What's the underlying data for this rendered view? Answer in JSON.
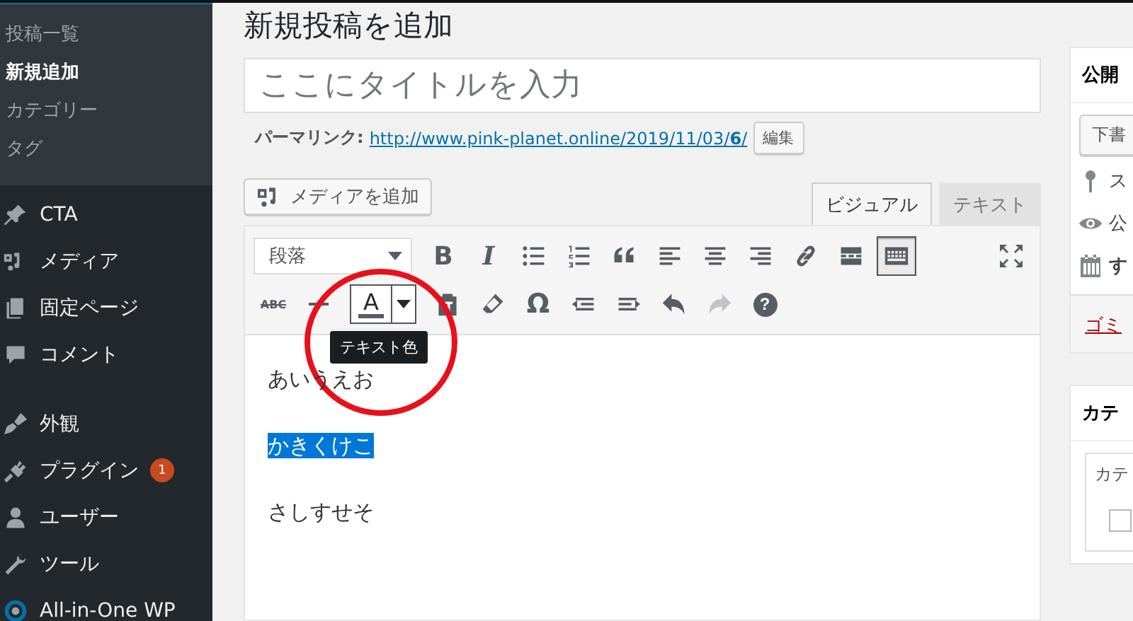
{
  "sidebar": {
    "submenu": [
      {
        "label": "投稿一覧",
        "selected": false
      },
      {
        "label": "新規追加",
        "selected": true
      },
      {
        "label": "カテゴリー",
        "selected": false
      },
      {
        "label": "タグ",
        "selected": false
      }
    ],
    "menu_groups": [
      [
        {
          "label": "CTA"
        },
        {
          "label": "メディア"
        },
        {
          "label": "固定ページ"
        },
        {
          "label": "コメント"
        }
      ],
      [
        {
          "label": "外観"
        },
        {
          "label": "プラグイン",
          "badge": "1"
        },
        {
          "label": "ユーザー"
        },
        {
          "label": "ツール"
        },
        {
          "label": "All-in-One WP"
        }
      ]
    ]
  },
  "page_title": "新規投稿を追加",
  "title_field": {
    "placeholder": "ここにタイトルを入力"
  },
  "permalink": {
    "label": "パーマリンク:",
    "url": "http://www.pink-planet.online/2019/11/03/",
    "url_bold": "6",
    "url_end": "/",
    "edit_button": "編集"
  },
  "media_button": "メディアを追加",
  "editor_tabs": [
    {
      "label": "ビジュアル",
      "selected": true
    },
    {
      "label": "テキスト",
      "selected": false
    }
  ],
  "toolbar_rows": [
    [
      {
        "kind": "format",
        "text": "段落"
      },
      {
        "kind": "bold",
        "text": "B"
      },
      {
        "kind": "italic",
        "text": "I"
      },
      {
        "kind": "bullets"
      },
      {
        "kind": "numbers"
      },
      {
        "kind": "quote"
      },
      {
        "kind": "alignleft"
      },
      {
        "kind": "aligncenter"
      },
      {
        "kind": "alignright"
      },
      {
        "kind": "link"
      },
      {
        "kind": "more"
      },
      {
        "kind": "toggle",
        "pressed": true
      },
      {
        "kind": "fullscreen"
      }
    ],
    [
      {
        "kind": "strike",
        "text": "ABC"
      },
      {
        "kind": "hr"
      },
      {
        "kind": "textcolor",
        "text": "A",
        "tooltip": "テキスト色"
      },
      {
        "kind": "paste"
      },
      {
        "kind": "eraser"
      },
      {
        "kind": "special",
        "text": "Ω"
      },
      {
        "kind": "outdent"
      },
      {
        "kind": "indent"
      },
      {
        "kind": "undo",
        "disabled": false
      },
      {
        "kind": "redo",
        "disabled": true
      },
      {
        "kind": "help",
        "text": "?"
      }
    ]
  ],
  "content": [
    {
      "text": "あいうえお",
      "selected": false
    },
    {
      "text": "かきくけこ",
      "selected": true
    },
    {
      "text": "さしすせそ",
      "selected": false
    }
  ],
  "publish_box": {
    "title": "公開",
    "draft_button": "下書",
    "rows": [
      {
        "text": "ス",
        "bold": false
      },
      {
        "text": "公",
        "bold": false
      },
      {
        "text": "す",
        "bold": true
      }
    ],
    "trash_link": "ゴミ"
  },
  "category_box": {
    "title": "カテ",
    "tab": "カテ",
    "checkbox_checked": false
  }
}
